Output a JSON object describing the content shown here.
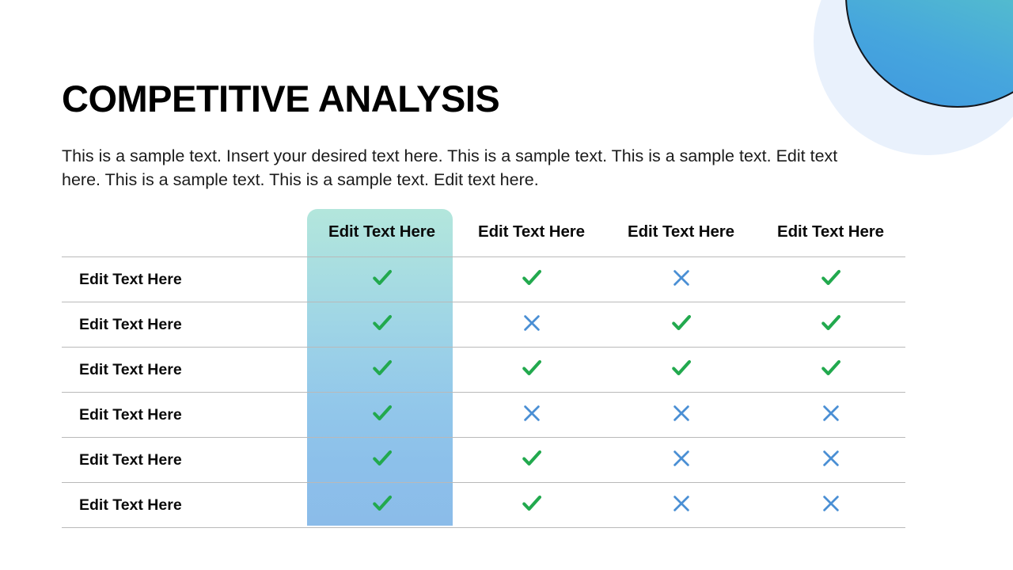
{
  "slide": {
    "title": "COMPETITIVE ANALYSIS",
    "subtitle": "This is a sample text. Insert your desired text here. This is a sample text. This is a sample text. Edit text here. This is a sample text. This is a sample text. Edit text here."
  },
  "decor": {
    "gradient_circle_from": "#6fd6c2",
    "gradient_circle_to": "#3f97e0",
    "gradient_circle_outline": "#14161c",
    "pale_circle": "#e9f1fc"
  },
  "table": {
    "corner_header": "",
    "highlight_column_index": 0,
    "highlight_gradient_from": "#b3e6dc",
    "highlight_gradient_to": "#8bbce9",
    "check_color": "#22a94e",
    "cross_color": "#4a8fd4",
    "divider_color": "#b9b9b9",
    "column_headers": [
      "Edit Text Here",
      "Edit Text Here",
      "Edit Text Here",
      "Edit Text Here"
    ],
    "rows": [
      {
        "label": "Edit Text Here",
        "cells": [
          "check",
          "check",
          "cross",
          "check"
        ]
      },
      {
        "label": "Edit Text Here",
        "cells": [
          "check",
          "cross",
          "check",
          "check"
        ]
      },
      {
        "label": "Edit Text Here",
        "cells": [
          "check",
          "check",
          "check",
          "check"
        ]
      },
      {
        "label": "Edit Text Here",
        "cells": [
          "check",
          "cross",
          "cross",
          "cross"
        ]
      },
      {
        "label": "Edit Text Here",
        "cells": [
          "check",
          "check",
          "cross",
          "cross"
        ]
      },
      {
        "label": "Edit Text Here",
        "cells": [
          "check",
          "check",
          "cross",
          "cross"
        ]
      }
    ]
  }
}
